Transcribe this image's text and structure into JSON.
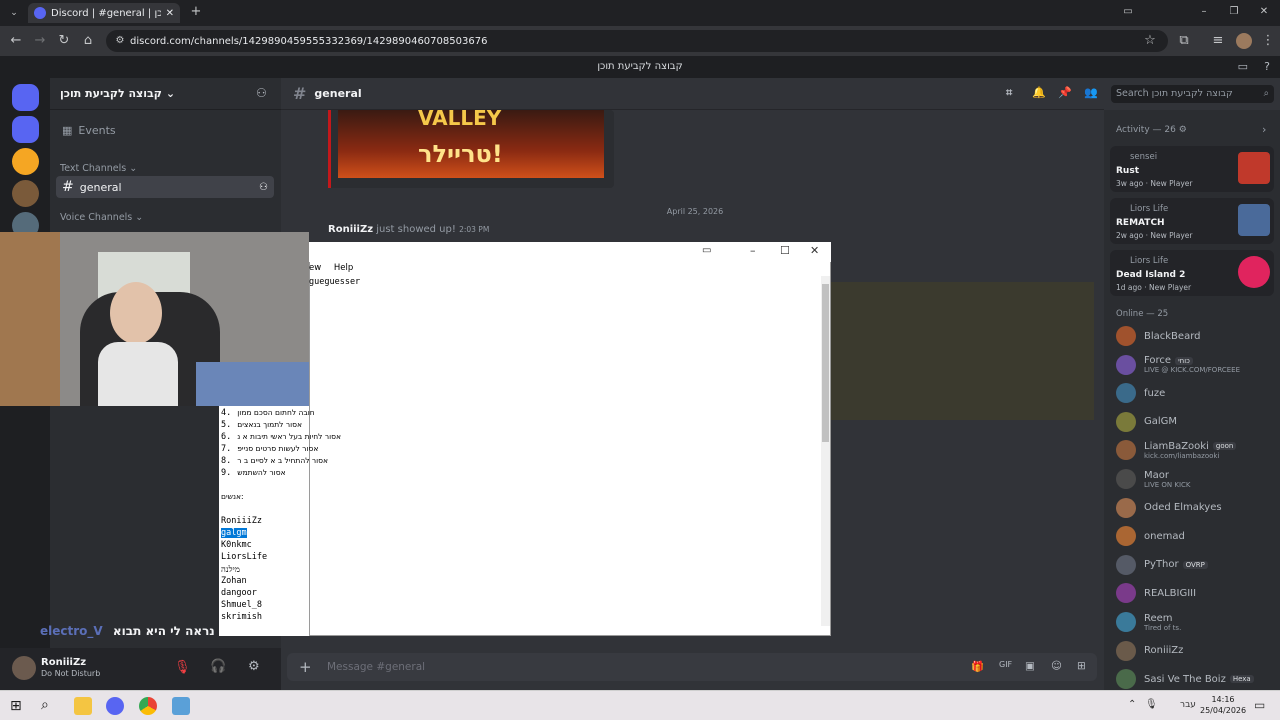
{
  "browser": {
    "tab_title": "Discord | #general | קבוצה לקביעת תוכן",
    "url": "discord.com/channels/1429890459555332369/1429890460708503676"
  },
  "discord": {
    "window_title": "קבוצה לקביעת תוכן",
    "server_name": "קבוצה לקביעת תוכן",
    "events_label": "Events",
    "text_channels_label": "Text Channels",
    "channel_name": "general",
    "voice_channels_label": "Voice Channels",
    "search_placeholder": "Search קבוצה לקביעת תוכן",
    "date_divider": "April 25, 2026",
    "join_message": {
      "user": "RoniiiZz",
      "text": "just showed up!",
      "time": "2:03 PM"
    },
    "trailer_text": "טריילר!",
    "trailer_top": "VALLEY",
    "message_placeholder": "Message #general",
    "user": {
      "name": "RoniiiZz",
      "status": "Do Not Disturb"
    },
    "overlay_caption": {
      "name": "electro_V",
      "text": "נראה לי היא תבוא"
    },
    "activity": {
      "header": "Activity — 26",
      "items": [
        {
          "user": "sensei",
          "title": "Rust",
          "time": "3w ago",
          "tag": "New Player"
        },
        {
          "user": "Liors Life",
          "title": "REMATCH",
          "time": "2w ago",
          "tag": "New Player"
        },
        {
          "user": "Liors Life",
          "title": "Dead Island 2",
          "time": "1d ago",
          "tag": "New Player"
        }
      ]
    },
    "online_header": "Online — 25",
    "members": [
      {
        "name": "BlackBeard",
        "sub": "",
        "color": "#b5bac1"
      },
      {
        "name": "Force",
        "sub": "LIVE @ KICK.COM/FORCEEE",
        "color": "#b5bac1",
        "badge": "כוחי"
      },
      {
        "name": "fuze",
        "sub": "",
        "color": "#b5bac1"
      },
      {
        "name": "GalGM",
        "sub": "",
        "color": "#b5bac1"
      },
      {
        "name": "LiamBaZooki",
        "sub": "kick.com/liambazooki",
        "color": "#b5bac1",
        "badge": "goon"
      },
      {
        "name": "Maor",
        "sub": "LIVE ON KICK",
        "color": "#b5bac1"
      },
      {
        "name": "Oded Elmakyes",
        "sub": "",
        "color": "#b5bac1"
      },
      {
        "name": "onemad",
        "sub": "",
        "color": "#b5bac1"
      },
      {
        "name": "PyThor",
        "sub": "",
        "color": "#b5bac1",
        "badge": "OVRP"
      },
      {
        "name": "REALBIGIII",
        "sub": "",
        "color": "#b5bac1"
      },
      {
        "name": "Reem",
        "sub": "Tired of ts.",
        "color": "#b5bac1"
      },
      {
        "name": "RoniiiZz",
        "sub": "",
        "color": "#b5bac1"
      },
      {
        "name": "Sasi Ve The Boiz",
        "sub": "",
        "color": "#b5bac1",
        "badge": "Hexa"
      }
    ]
  },
  "notepad": {
    "menu_view": "ew",
    "menu_help": "Help",
    "first_line": "gueguesser",
    "rules": [
      {
        "num": "4.",
        "text": "חובה לחתום הסכם ממון"
      },
      {
        "num": "5.",
        "text": "אסור לתמוך בנאצים"
      },
      {
        "num": "6.",
        "text": "אסור לחיות בעל ראשי תיבות א נ"
      },
      {
        "num": "7.",
        "text": "אסור לעשות סרטים סנייפ"
      },
      {
        "num": "8.",
        "text": "אסור להתחיל ב א לסיים ב ר"
      },
      {
        "num": "9.",
        "text": "אסור להשתמש"
      }
    ],
    "people_label": "אנשים:",
    "people": [
      "RoniiiZz",
      "galgm",
      "K0nkmc",
      "LiorsLife",
      "מילנה",
      "Zohan",
      "dangoor",
      "Shmuel_8",
      "skrimish"
    ]
  },
  "taskbar": {
    "time": "14:16",
    "date": "25/04/2026",
    "lang": "עבר"
  }
}
